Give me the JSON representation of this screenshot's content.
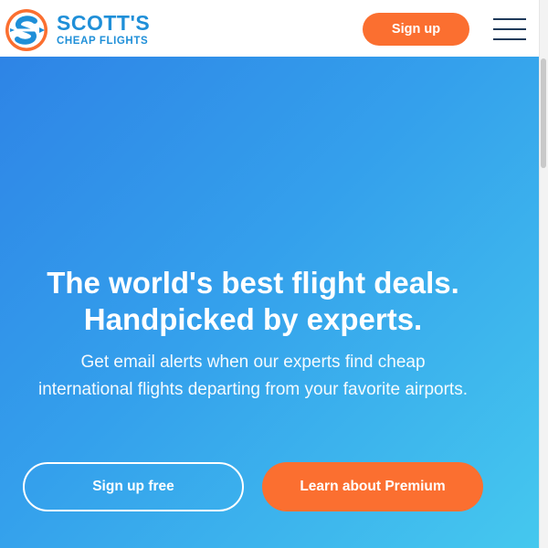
{
  "header": {
    "logo": {
      "title": "SCOTT'S",
      "subtitle": "CHEAP FLIGHTS",
      "icon": "plane-s-logo-icon"
    },
    "signup_label": "Sign up",
    "menu_icon": "hamburger-menu-icon"
  },
  "hero": {
    "headline_line1": "The world's best flight deals.",
    "headline_line2": "Handpicked by experts.",
    "subtext": "Get email alerts when our experts find cheap international flights departing from your favorite airports.",
    "cta_free_label": "Sign up free",
    "cta_premium_label": "Learn about Premium"
  },
  "colors": {
    "brand_blue": "#1f8fd8",
    "accent_orange": "#fb6f30",
    "hero_gradient_start": "#2e84e6",
    "hero_gradient_end": "#45c8ee"
  }
}
